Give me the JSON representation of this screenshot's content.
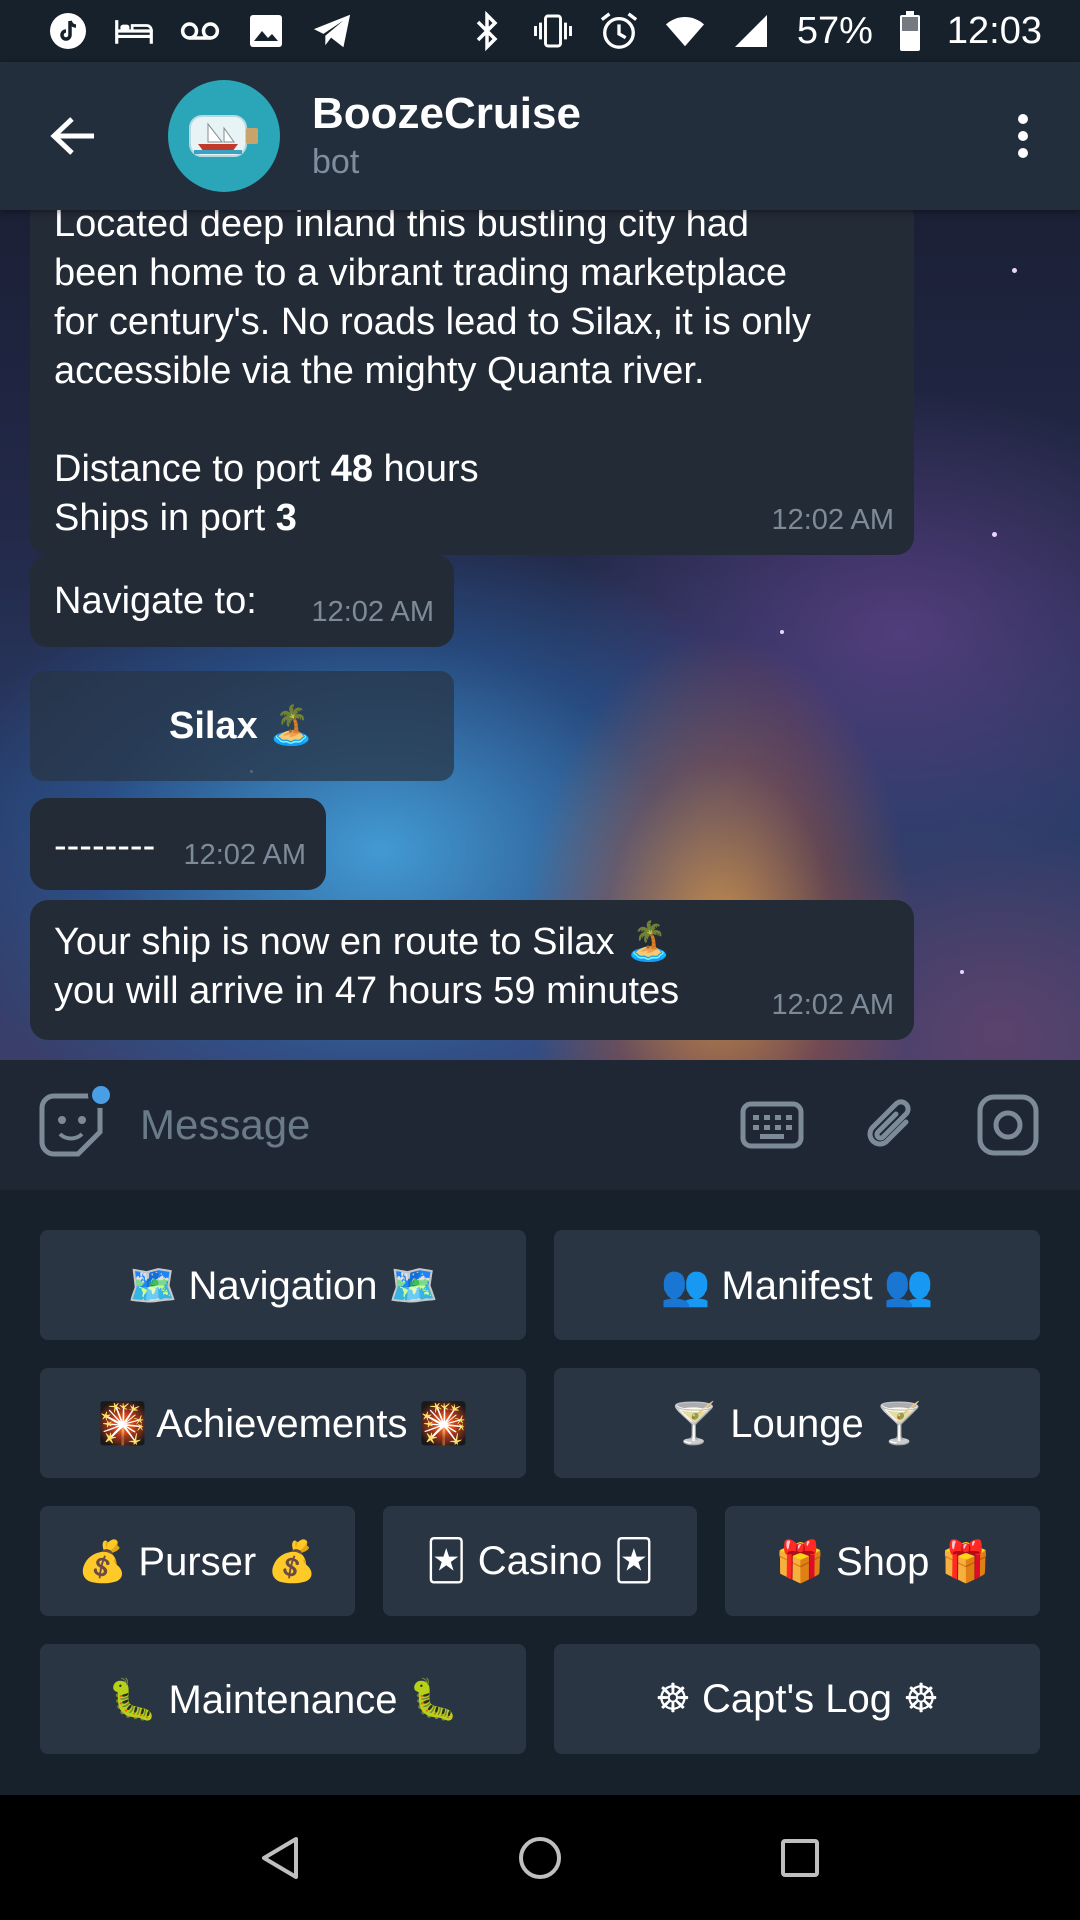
{
  "status_bar": {
    "battery": "57%",
    "time": "12:03",
    "left_icons": [
      "tiktok-icon",
      "bed-icon",
      "voicemail-icon",
      "image-icon",
      "telegram-icon"
    ],
    "right_icons": [
      "bluetooth-icon",
      "vibrate-icon",
      "alarm-icon",
      "wifi-icon",
      "signal-icon",
      "battery-icon"
    ]
  },
  "header": {
    "title": "BoozeCruise",
    "subtitle": "bot"
  },
  "messages": {
    "m1": {
      "lines": [
        "Located deep inland this bustling city had",
        "been home to a vibrant trading marketplace",
        "for century's. No roads lead to Silax, it is only",
        "accessible via the mighty Quanta river."
      ],
      "distance_label": "Distance to port",
      "distance_value": "48",
      "distance_unit": "hours",
      "ships_label": "Ships in port",
      "ships_value": "3",
      "time": "12:02 AM"
    },
    "m2": {
      "text": "Navigate to:",
      "time": "12:02 AM"
    },
    "inline_button": {
      "label": "Silax",
      "emoji": "🏝️"
    },
    "m3": {
      "text": "--------",
      "time": "12:02 AM"
    },
    "m4": {
      "line1": "Your ship is now en route to Silax 🏝️",
      "line2": "you will arrive in 47 hours 59 minutes",
      "time": "12:02 AM"
    }
  },
  "input": {
    "placeholder": "Message"
  },
  "keyboard": {
    "rows": [
      [
        "🗺️ Navigation 🗺️",
        "👥 Manifest 👥"
      ],
      [
        "🎇 Achievements 🎇",
        "🍸 Lounge 🍸"
      ],
      [
        "💰 Purser 💰",
        "🃏 Casino 🃏",
        "🎁 Shop 🎁"
      ],
      [
        "🐛 Maintenance 🐛",
        "☸ Capt's Log ☸"
      ]
    ]
  },
  "colors": {
    "header_bg": "#232e3c",
    "bubble_bg": "#232b37",
    "keyboard_bg": "#17212b",
    "key_bg": "#2a3544",
    "accent": "#4a9ee6"
  }
}
